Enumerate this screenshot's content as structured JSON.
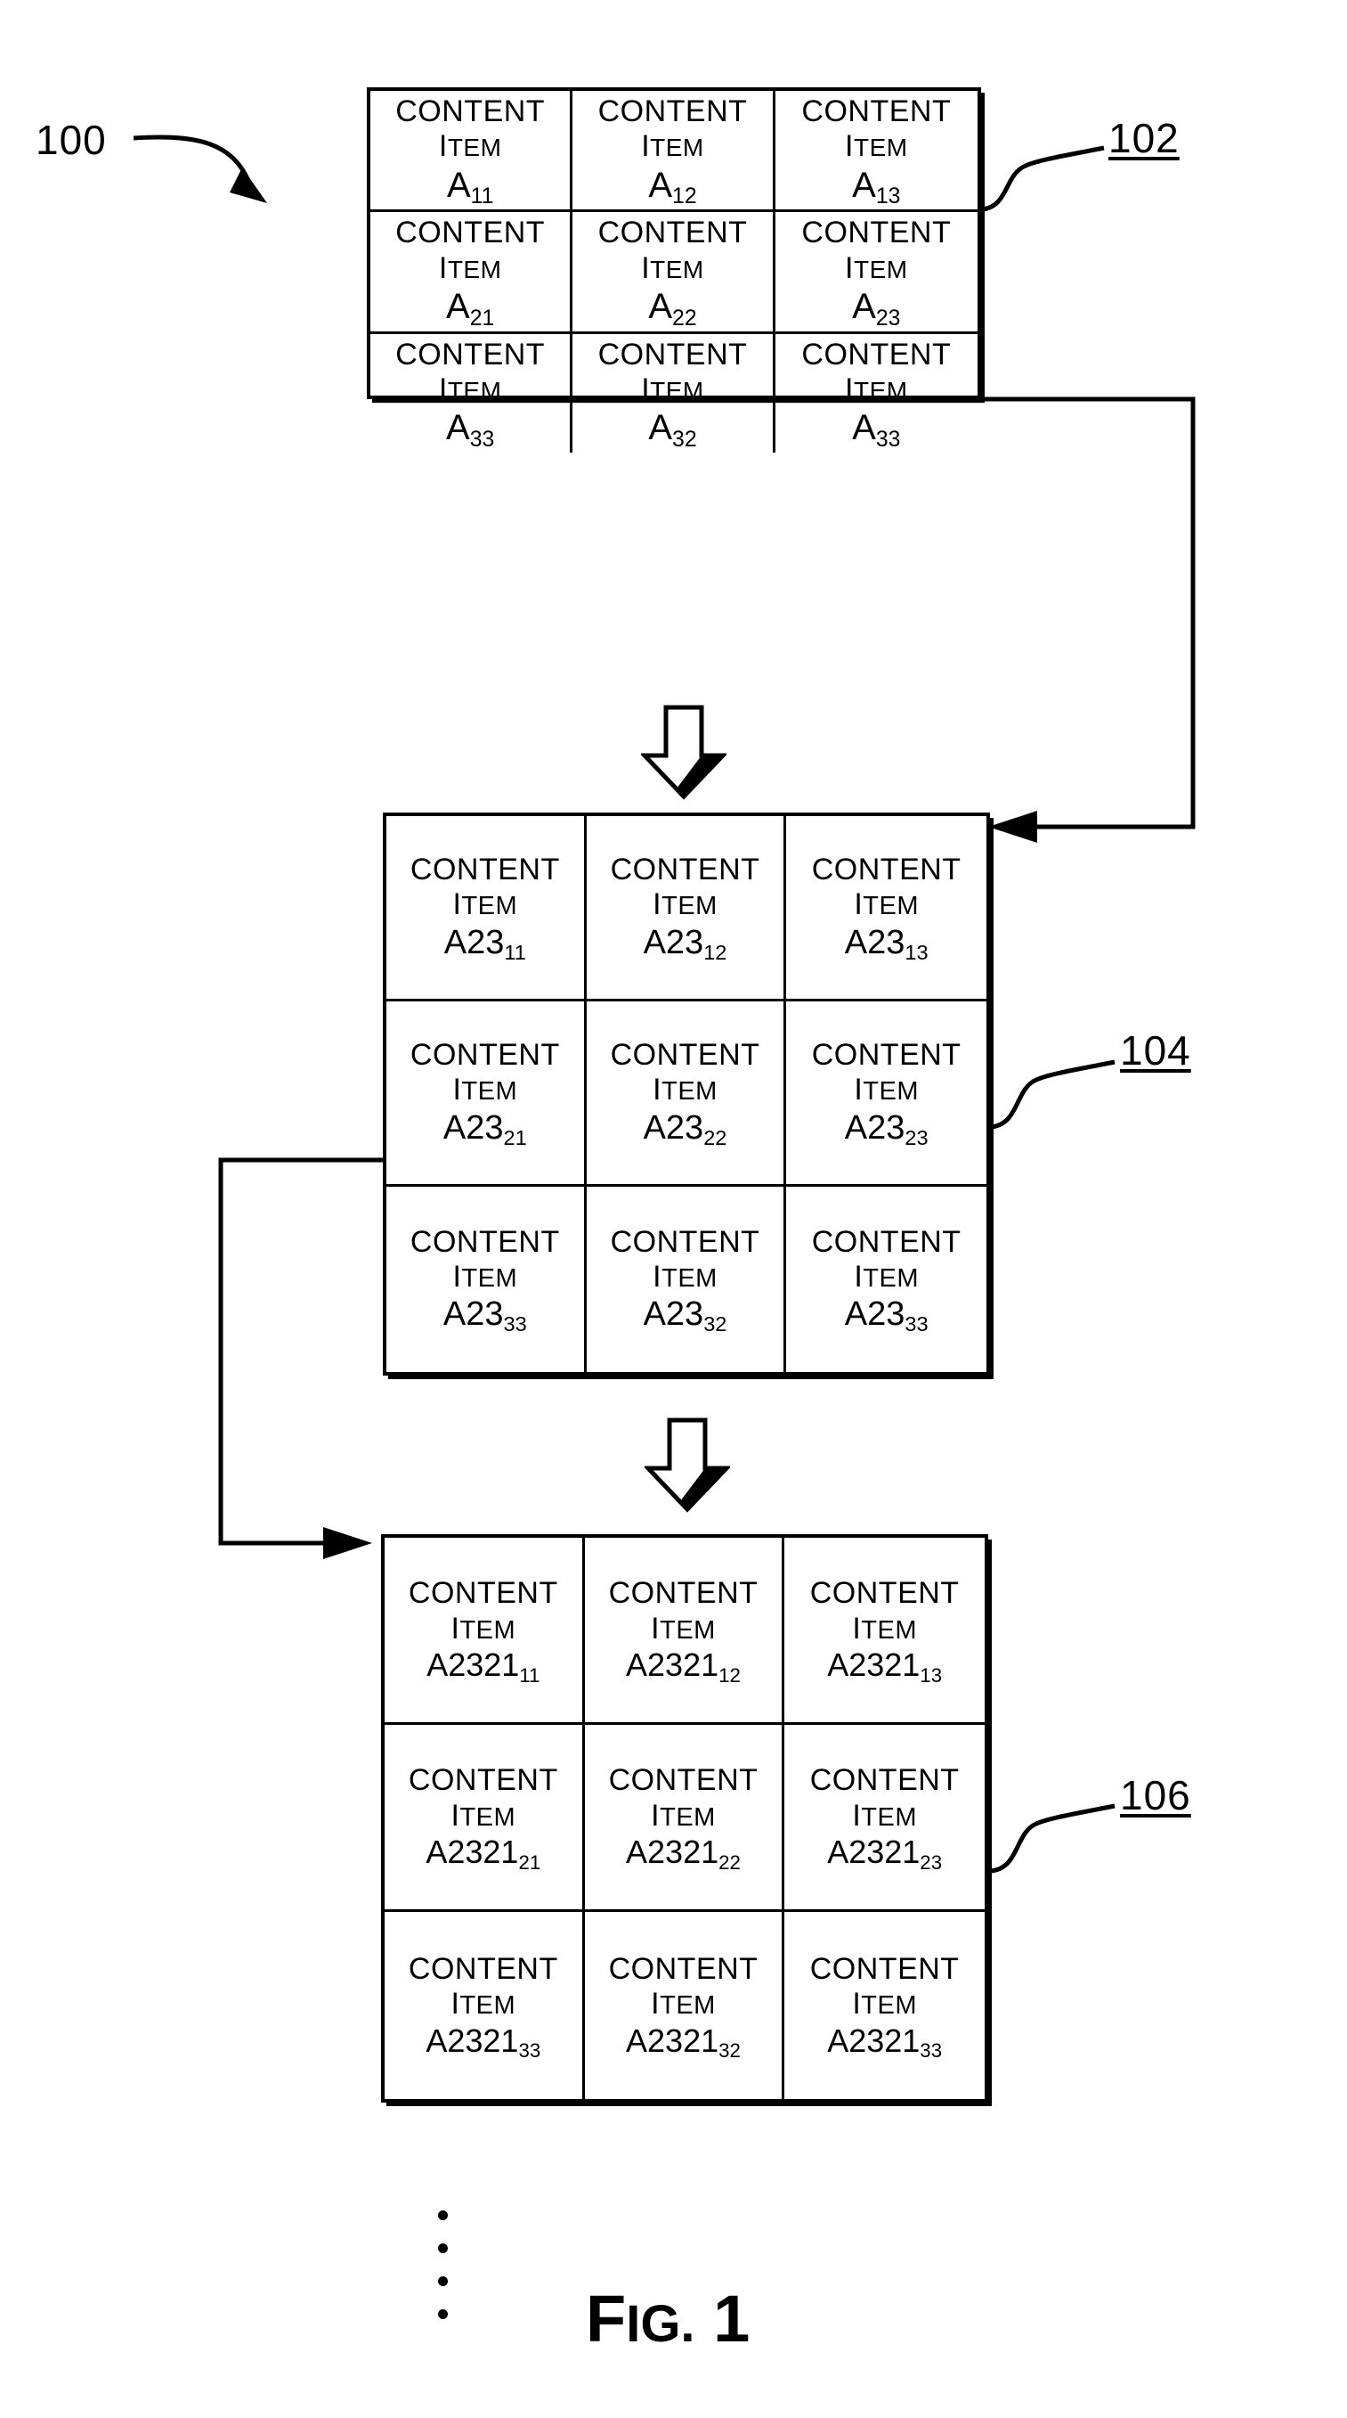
{
  "figure": {
    "caption_prefix": "F",
    "caption_mid": "IG.",
    "caption_number": "1",
    "system_label": "100"
  },
  "grids": [
    {
      "id": "102",
      "ref_label": "102",
      "rows": [
        [
          {
            "label_line1": "CONTENT",
            "label_line2": "ITEM",
            "id_base": "A",
            "id_sub": "11"
          },
          {
            "label_line1": "CONTENT",
            "label_line2": "ITEM",
            "id_base": "A",
            "id_sub": "12"
          },
          {
            "label_line1": "CONTENT",
            "label_line2": "ITEM",
            "id_base": "A",
            "id_sub": "13"
          }
        ],
        [
          {
            "label_line1": "CONTENT",
            "label_line2": "ITEM",
            "id_base": "A",
            "id_sub": "21"
          },
          {
            "label_line1": "CONTENT",
            "label_line2": "ITEM",
            "id_base": "A",
            "id_sub": "22"
          },
          {
            "label_line1": "CONTENT",
            "label_line2": "ITEM",
            "id_base": "A",
            "id_sub": "23"
          }
        ],
        [
          {
            "label_line1": "CONTENT",
            "label_line2": "ITEM",
            "id_base": "A",
            "id_sub": "33"
          },
          {
            "label_line1": "CONTENT",
            "label_line2": "ITEM",
            "id_base": "A",
            "id_sub": "32"
          },
          {
            "label_line1": "CONTENT",
            "label_line2": "ITEM",
            "id_base": "A",
            "id_sub": "33"
          }
        ]
      ]
    },
    {
      "id": "104",
      "ref_label": "104",
      "rows": [
        [
          {
            "label_line1": "CONTENT",
            "label_line2": "ITEM",
            "id_base": "A23",
            "id_sub": "11"
          },
          {
            "label_line1": "CONTENT",
            "label_line2": "ITEM",
            "id_base": "A23",
            "id_sub": "12"
          },
          {
            "label_line1": "CONTENT",
            "label_line2": "ITEM",
            "id_base": "A23",
            "id_sub": "13"
          }
        ],
        [
          {
            "label_line1": "CONTENT",
            "label_line2": "ITEM",
            "id_base": "A23",
            "id_sub": "21"
          },
          {
            "label_line1": "CONTENT",
            "label_line2": "ITEM",
            "id_base": "A23",
            "id_sub": "22"
          },
          {
            "label_line1": "CONTENT",
            "label_line2": "ITEM",
            "id_base": "A23",
            "id_sub": "23"
          }
        ],
        [
          {
            "label_line1": "CONTENT",
            "label_line2": "ITEM",
            "id_base": "A23",
            "id_sub": "33"
          },
          {
            "label_line1": "CONTENT",
            "label_line2": "ITEM",
            "id_base": "A23",
            "id_sub": "32"
          },
          {
            "label_line1": "CONTENT",
            "label_line2": "ITEM",
            "id_base": "A23",
            "id_sub": "33"
          }
        ]
      ]
    },
    {
      "id": "106",
      "ref_label": "106",
      "rows": [
        [
          {
            "label_line1": "CONTENT",
            "label_line2": "ITEM",
            "id_base": "A2321",
            "id_sub": "11"
          },
          {
            "label_line1": "CONTENT",
            "label_line2": "ITEM",
            "id_base": "A2321",
            "id_sub": "12"
          },
          {
            "label_line1": "CONTENT",
            "label_line2": "ITEM",
            "id_base": "A2321",
            "id_sub": "13"
          }
        ],
        [
          {
            "label_line1": "CONTENT",
            "label_line2": "ITEM",
            "id_base": "A2321",
            "id_sub": "21"
          },
          {
            "label_line1": "CONTENT",
            "label_line2": "ITEM",
            "id_base": "A2321",
            "id_sub": "22"
          },
          {
            "label_line1": "CONTENT",
            "label_line2": "ITEM",
            "id_base": "A2321",
            "id_sub": "23"
          }
        ],
        [
          {
            "label_line1": "CONTENT",
            "label_line2": "ITEM",
            "id_base": "A2321",
            "id_sub": "33"
          },
          {
            "label_line1": "CONTENT",
            "label_line2": "ITEM",
            "id_base": "A2321",
            "id_sub": "32"
          },
          {
            "label_line1": "CONTENT",
            "label_line2": "ITEM",
            "id_base": "A2321",
            "id_sub": "33"
          }
        ]
      ]
    }
  ],
  "colors": {
    "ink": "#000000",
    "paper": "#ffffff"
  }
}
